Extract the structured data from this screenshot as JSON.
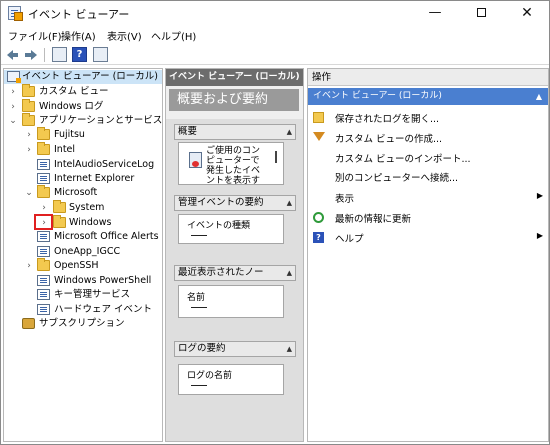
{
  "window": {
    "title": "イベント ビューアー",
    "minimize": "—",
    "close": "✕"
  },
  "menu": [
    "ファイル(F)",
    "操作(A)",
    "表示(V)",
    "ヘルプ(H)"
  ],
  "tree": {
    "items": [
      {
        "label": "イベント ビューアー (ローカル)",
        "icon": "viewer-icon"
      },
      {
        "label": "カスタム ビュー",
        "icon": "folder-icon",
        "chev": "›"
      },
      {
        "label": "Windows ログ",
        "icon": "folder-icon",
        "chev": "›"
      },
      {
        "label": "アプリケーションとサービス ログ",
        "icon": "folder-icon",
        "chev": "⌄"
      },
      {
        "label": "Fujitsu",
        "icon": "folder-icon",
        "chev": "›"
      },
      {
        "label": "Intel",
        "icon": "folder-icon",
        "chev": "›"
      },
      {
        "label": "IntelAudioServiceLog",
        "icon": "log-icon"
      },
      {
        "label": "Internet Explorer",
        "icon": "log-icon"
      },
      {
        "label": "Microsoft",
        "icon": "folder-icon",
        "chev": "⌄"
      },
      {
        "label": "System",
        "icon": "folder-icon",
        "chev": "›"
      },
      {
        "label": "Windows",
        "icon": "folder-icon",
        "chev": "›"
      },
      {
        "label": "Microsoft Office Alerts",
        "icon": "log-icon"
      },
      {
        "label": "OneApp_IGCC",
        "icon": "log-icon"
      },
      {
        "label": "OpenSSH",
        "icon": "folder-icon",
        "chev": "›"
      },
      {
        "label": "Windows PowerShell",
        "icon": "log-icon"
      },
      {
        "label": "キー管理サービス",
        "icon": "log-icon"
      },
      {
        "label": "ハードウェア イベント",
        "icon": "log-icon"
      },
      {
        "label": "サブスクリプション",
        "icon": "subscription-icon"
      }
    ]
  },
  "middle": {
    "header": "イベント ビューアー (ローカル)",
    "title": "概要および要約",
    "overview": {
      "heading": "概要",
      "text_lines": [
        "ご使用のコン",
        "ピューターで",
        "発生したイベ",
        "ントを表示す"
      ]
    },
    "admin_summary": {
      "heading": "管理イベントの要約",
      "col": "イベントの種類"
    },
    "recent_views": {
      "heading": "最近表示されたノー",
      "col": "名前"
    },
    "log_summary": {
      "heading": "ログの要約",
      "col": "ログの名前"
    },
    "collapse_glyph": "▲"
  },
  "actions": {
    "header": "操作",
    "section": "イベント ビューアー (ローカル)",
    "items": [
      {
        "label": "保存されたログを開く...",
        "icon": "open-folder-icon"
      },
      {
        "label": "カスタム ビューの作成...",
        "icon": "filter-icon"
      },
      {
        "label": "カスタム ビューのインポート...",
        "icon": "none"
      },
      {
        "label": "別のコンピューターへ接続...",
        "icon": "none"
      },
      {
        "label": "表示",
        "icon": "none",
        "submenu": "▶"
      },
      {
        "label": "最新の情報に更新",
        "icon": "refresh-icon"
      },
      {
        "label": "ヘルプ",
        "icon": "help-icon",
        "submenu": "▶"
      }
    ]
  },
  "colors": {
    "accent": "#4a7fd0",
    "mid_header": "#6c6c6c",
    "highlight": "#e02020"
  }
}
